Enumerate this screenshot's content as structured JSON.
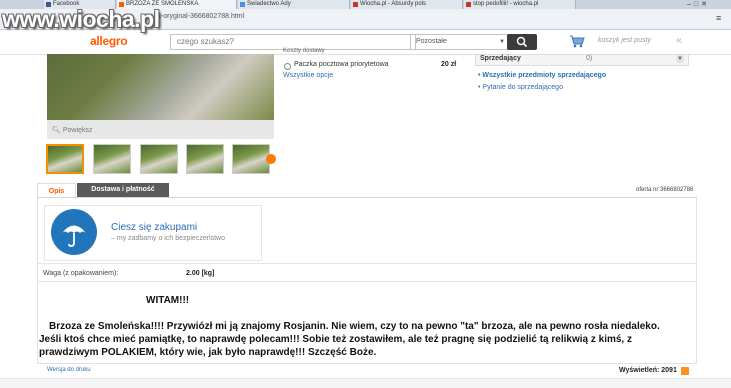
{
  "watermark": "www.wiocha.pl",
  "browser": {
    "tabs": [
      {
        "label": "Facebook",
        "color": "#3b5998"
      },
      {
        "label": "BRZOZA ZE SMOLEŃSKA",
        "color": "#ff5a00"
      },
      {
        "label": "Świadectwo Ady",
        "color": "#4a90d9"
      },
      {
        "label": "Wiocha.pl - Absurdy pols",
        "color": "#c0392b"
      },
      {
        "label": "stop pedofilii! - wiocha.pl",
        "color": "#c0392b"
      }
    ],
    "url": "ska-oryginal-3666802788.html",
    "window_controls": "–□✕"
  },
  "header": {
    "logo": "allegro",
    "search_placeholder": "czego szukasz?",
    "category": "Pozostałe",
    "cart_text": "koszyk jest pusty",
    "collapse": "«"
  },
  "gallery": {
    "zoom_label": "Powiększ",
    "thumb_count": 5,
    "selected_thumb": 0
  },
  "shipping": {
    "section_cut": "Koszty dostawy",
    "method": "Paczka pocztowa priorytetowa",
    "price": "20 zł",
    "options_link": "Wszystkie opcje"
  },
  "seller": {
    "label": "Sprzedający",
    "count": "0)",
    "items_link": "Wszystkie przedmioty sprzedającego",
    "ask_link": "Pytanie do sprzedającego"
  },
  "tabs": {
    "description": "Opis",
    "delivery": "Dostawa i płatność",
    "offer_number": "oferta nr 3666802788"
  },
  "promo": {
    "title": "Ciesz się zakupami",
    "subtitle": "my zadbamy o ich bezpieczeństwo"
  },
  "weight": {
    "label": "Waga (z opakowaniem):",
    "value": "2.00 [kg]"
  },
  "description": {
    "greeting": "WITAM!!!",
    "line1": "Brzoza ze Smoleńska!!!! Przywiózł mi ją znajomy Rosjanin. Nie wiem, czy to na pewno \"ta\" brzoza, ale na pewno rosła niedaleko.",
    "line2": "Jeśli ktoś chce mieć pamiątkę, to naprawdę polecam!!! Sobie też zostawiłem, ale też pragnę się podzielić tą relikwią z kimś, z",
    "line3": "prawdziwym POLAKIEM, który wie, jak było naprawdę!!! Szczęść Boże."
  },
  "footer": {
    "print_link": "Wersja do druku",
    "views": "Wyświetleń: 2091"
  }
}
